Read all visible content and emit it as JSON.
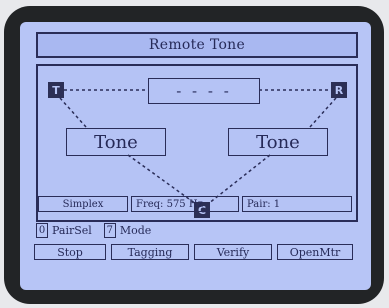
{
  "header": {
    "title": "Remote Tone"
  },
  "diagram": {
    "node_left": "T",
    "node_right": "R",
    "node_bottom": "C",
    "center_display": "- - - -",
    "tone_left": "Tone",
    "tone_right": "Tone"
  },
  "status": {
    "mode": "Simplex",
    "freq": "Freq: 575 Hz",
    "pair": "Pair:   1"
  },
  "options": [
    {
      "num": "0",
      "label": "PairSel"
    },
    {
      "num": "7",
      "label": "Mode"
    }
  ],
  "buttons": {
    "stop": "Stop",
    "tagging": "Tagging",
    "verify": "Verify",
    "openmtr": "OpenMtr"
  },
  "colors": {
    "screen_bg": "#b7c5f6",
    "ink": "#2a2d58",
    "bezel": "#222426"
  }
}
